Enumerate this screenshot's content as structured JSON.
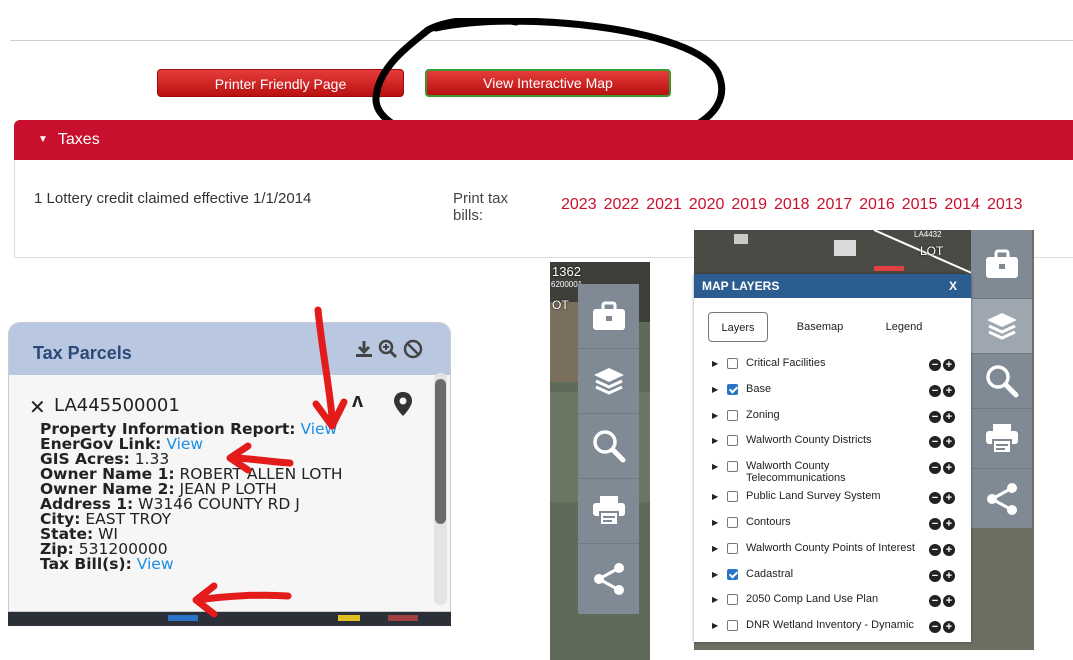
{
  "site": {
    "buttons": {
      "printer": "Printer Friendly Page",
      "map": "View Interactive Map"
    },
    "section": "Taxes",
    "lottery": "1 Lottery credit claimed effective 1/1/2014",
    "print_label": "Print tax bills:",
    "years": [
      "2023",
      "2022",
      "2021",
      "2020",
      "2019",
      "2018",
      "2017",
      "2016",
      "2015",
      "2014",
      "2013"
    ]
  },
  "parcels": {
    "title": "Tax Parcels",
    "parcel_id": "LA445500001",
    "rows": [
      {
        "key": "Property Information Report:",
        "link": "View"
      },
      {
        "key": "EnerGov Link:",
        "link": "View"
      },
      {
        "key": "GIS Acres:",
        "value": "1.33"
      },
      {
        "key": "Owner Name 1:",
        "value": "ROBERT ALLEN LOTH"
      },
      {
        "key": "Owner Name 2:",
        "value": "JEAN P LOTH"
      },
      {
        "key": "Address 1:",
        "value": "W3146 COUNTY RD J"
      },
      {
        "key": "City:",
        "value": "EAST TROY"
      },
      {
        "key": "State:",
        "value": "WI"
      },
      {
        "key": "Zip:",
        "value": "531200000"
      },
      {
        "key": "Tax Bill(s):",
        "link": "View"
      }
    ]
  },
  "map_layers": {
    "title": "MAP LAYERS",
    "close": "X",
    "tabs": [
      "Layers",
      "Basemap",
      "Legend"
    ],
    "layers": [
      {
        "name": "Critical Facilities",
        "checked": false
      },
      {
        "name": "Base",
        "checked": true
      },
      {
        "name": "Zoning",
        "checked": false
      },
      {
        "name": "Walworth County Districts",
        "checked": false
      },
      {
        "name": "Walworth County Telecommunications",
        "checked": false
      },
      {
        "name": "Public Land Survey System",
        "checked": false
      },
      {
        "name": "Contours",
        "checked": false
      },
      {
        "name": "Walworth County Points of Interest",
        "checked": false
      },
      {
        "name": "Cadastral",
        "checked": true
      },
      {
        "name": "2050 Comp Land Use Plan",
        "checked": false
      },
      {
        "name": "DNR Wetland Inventory - Dynamic",
        "checked": false
      }
    ]
  },
  "map_labels": {
    "lot": "LOT",
    "parcel_a": "LA4432",
    "parcel_b": "1362",
    "parcel_c": "OT",
    "parcel_d": "6200001"
  },
  "icons": [
    "toolbox-icon",
    "layers-icon",
    "search-icon",
    "print-icon",
    "share-icon",
    "download-icon",
    "zoom-icon",
    "clear-icon",
    "pin-icon"
  ],
  "colors": {
    "accent_red": "#c8102e",
    "link_blue": "#1a8ee0",
    "panel_head": "#b9c7e0",
    "ml_head": "#2b5d91"
  }
}
